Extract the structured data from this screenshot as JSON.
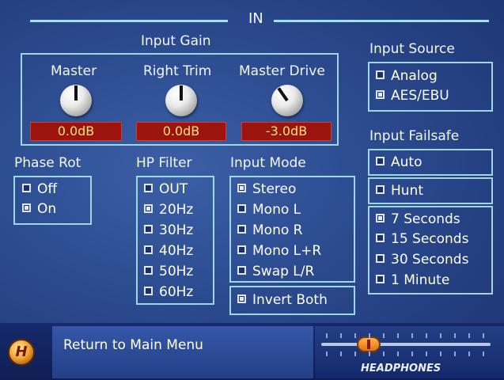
{
  "header": {
    "title": "IN"
  },
  "input_gain": {
    "title": "Input Gain",
    "knobs": [
      {
        "label": "Master",
        "value": "0.0dB"
      },
      {
        "label": "Right Trim",
        "value": "0.0dB"
      },
      {
        "label": "Master Drive",
        "value": "-3.0dB"
      }
    ]
  },
  "phase_rot": {
    "title": "Phase Rot",
    "options": [
      {
        "label": "Off",
        "checked": false
      },
      {
        "label": "On",
        "checked": true
      }
    ]
  },
  "hp_filter": {
    "title": "HP Filter",
    "options": [
      {
        "label": "OUT",
        "checked": false
      },
      {
        "label": "20Hz",
        "checked": true
      },
      {
        "label": "30Hz",
        "checked": false
      },
      {
        "label": "40Hz",
        "checked": false
      },
      {
        "label": "50Hz",
        "checked": false
      },
      {
        "label": "60Hz",
        "checked": false
      }
    ]
  },
  "input_mode": {
    "title": "Input Mode",
    "options": [
      {
        "label": "Stereo",
        "checked": true
      },
      {
        "label": "Mono L",
        "checked": false
      },
      {
        "label": "Mono R",
        "checked": false
      },
      {
        "label": "Mono L+R",
        "checked": false
      },
      {
        "label": "Swap L/R",
        "checked": false
      }
    ],
    "invert": {
      "label": "Invert Both",
      "checked": true
    }
  },
  "input_source": {
    "title": "Input Source",
    "options": [
      {
        "label": "Analog",
        "checked": false
      },
      {
        "label": "AES/EBU",
        "checked": true
      }
    ]
  },
  "input_failsafe": {
    "title": "Input Failsafe",
    "auto": {
      "label": "Auto",
      "checked": false
    },
    "hunt": {
      "label": "Hunt",
      "checked": false
    },
    "durations": [
      {
        "label": "7 Seconds",
        "checked": true
      },
      {
        "label": "15 Seconds",
        "checked": false
      },
      {
        "label": "30 Seconds",
        "checked": false
      },
      {
        "label": "1 Minute",
        "checked": false
      }
    ]
  },
  "footer": {
    "logo_letter": "H",
    "menu_text": "Return to Main Menu",
    "headphones_label": "HEADPHONES",
    "headphones_level": 0.28
  },
  "colors": {
    "accent_line": "#9ee3ea",
    "readout_bg": "#9b140e",
    "readout_text": "#ffe07a"
  }
}
